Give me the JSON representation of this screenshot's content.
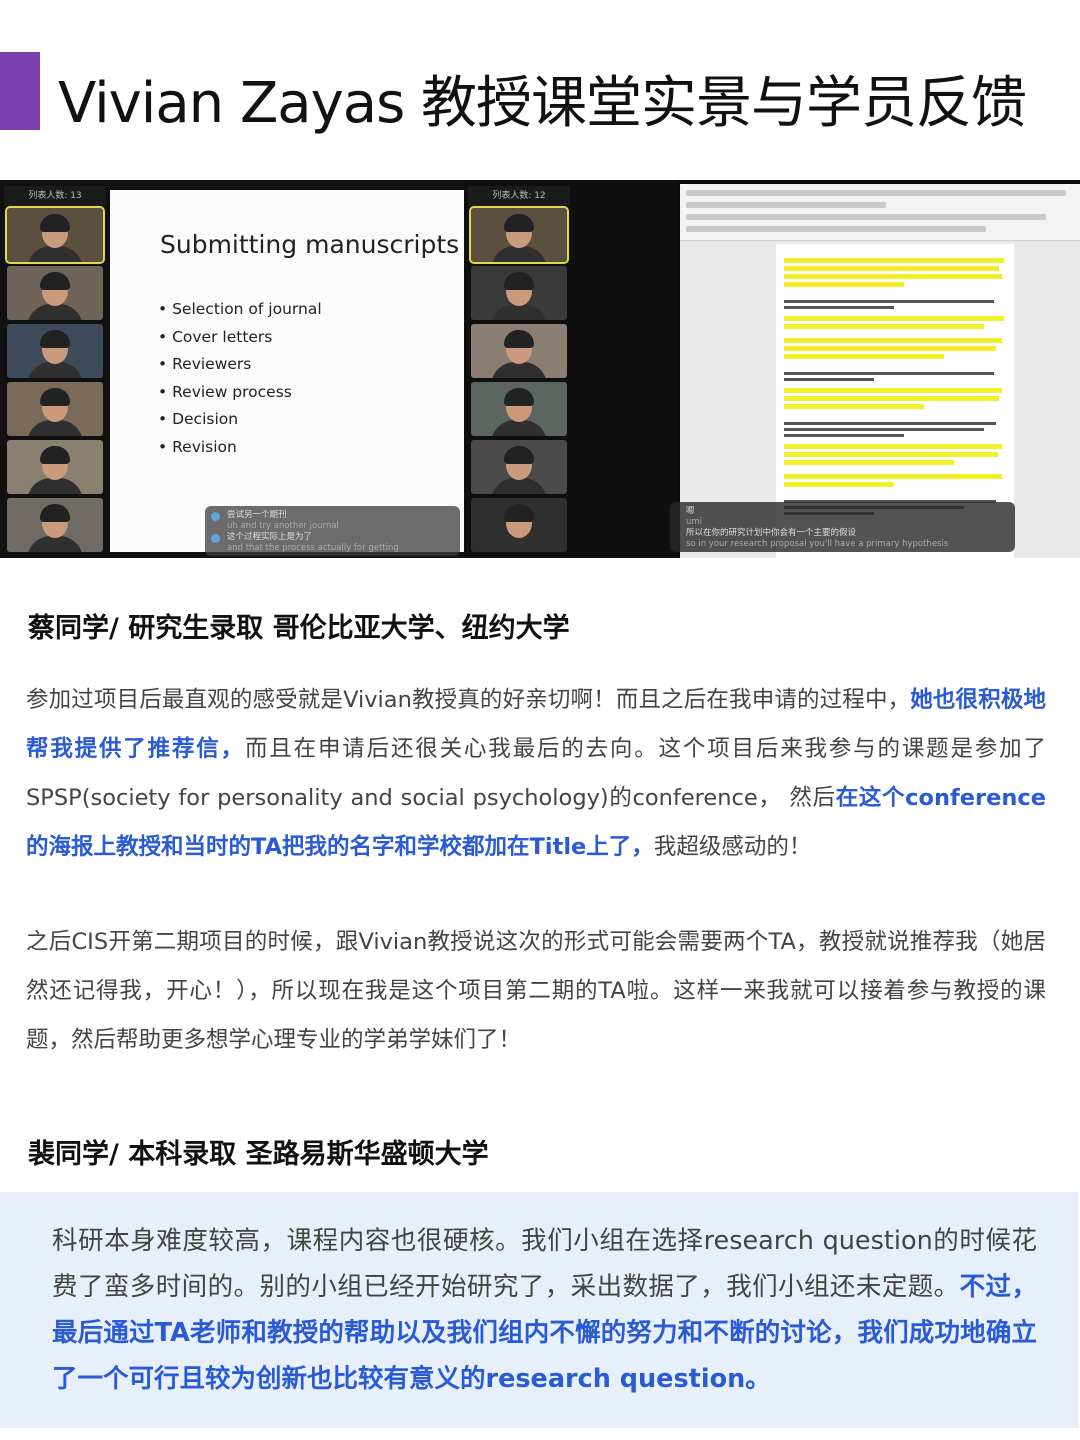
{
  "title": "Vivian Zayas 教授课堂实景与学员反馈",
  "slide": {
    "title": "Submitting manuscripts",
    "bullets": [
      "Selection of journal",
      "Cover letters",
      "Reviewers",
      "Review process",
      "Decision",
      "Revision"
    ],
    "participants_left": "列表人数: 13",
    "participants_right": "列表人数: 12",
    "caption_left": [
      "尝试另一个期刊",
      "uh and try another journal",
      "这个过程实际上是为了",
      "and that the process actually for getting"
    ],
    "caption_right": [
      "嗯",
      "umi",
      "所以在你的研究计划中你会有一个主要的假设",
      "so in your research proposal you'll have a primary hypothesis"
    ]
  },
  "section1": {
    "heading": "蔡同学/ 研究生录取 哥伦比亚大学、纽约大学",
    "p1": {
      "a": "参加过项目后最直观的感受就是Vivian教授真的好亲切啊！而且之后在我申请的过程中，",
      "b": "她也很积极地帮我提供了推荐信，",
      "c": "而且在申请后还很关心我最后的去向。这个项目后来我参与的课题是参加了SPSP(society for personality and social psychology)的conference， 然后",
      "d": "在这个conference的海报上教授和当时的TA把我的名字和学校都加在Title上了，",
      "e": "我超级感动的！"
    },
    "p2": "之后CIS开第二期项目的时候，跟Vivian教授说这次的形式可能会需要两个TA，教授就说推荐我（她居然还记得我，开心！），所以现在我是这个项目第二期的TA啦。这样一来我就可以接着参与教授的课题，然后帮助更多想学心理专业的学弟学妹们了！"
  },
  "section2": {
    "heading": "裴同学/ 本科录取 圣路易斯华盛顿大学",
    "p": {
      "a": "科研本身难度较高，课程内容也很硬核。我们小组在选择research question的时候花费了蛮多时间的。别的小组已经开始研究了，采出数据了，我们小组还未定题。",
      "b": "不过，最后通过TA老师和教授的帮助以及我们组内不懈的努力和不断的讨论，我们成功地确立了一个可行且较为创新也比较有意义的research question。"
    }
  },
  "colors": {
    "accent": "#7b3fb0",
    "highlight_text": "#2a5bd4",
    "box_bg": "#e7f0fa"
  }
}
